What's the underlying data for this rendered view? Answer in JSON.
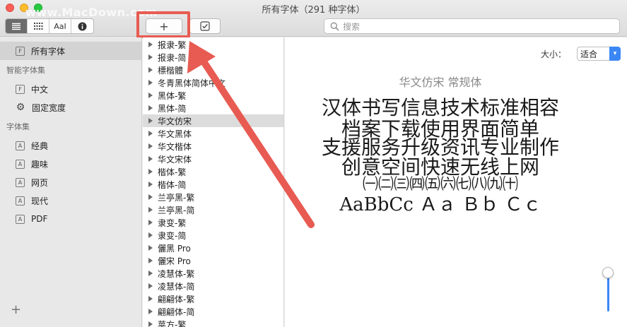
{
  "window": {
    "title": "所有字体（291 种字体）",
    "watermark": "www.MacDown.com"
  },
  "toolbar": {
    "view_buttons": [
      {
        "name": "list-view-icon",
        "active": true
      },
      {
        "name": "grid-view-icon",
        "active": false
      },
      {
        "label": "AaI",
        "name": "sample-view-button",
        "active": false
      },
      {
        "name": "info-icon",
        "active": false
      }
    ],
    "add_label": "+",
    "search_placeholder": "搜索"
  },
  "sidebar": {
    "items": [
      {
        "label": "所有字体",
        "icon": "font-icon",
        "selected": true
      }
    ],
    "groups": [
      {
        "title": "智能字体集",
        "items": [
          {
            "label": "中文",
            "icon": "font-icon"
          },
          {
            "label": "固定宽度",
            "icon": "gear-icon"
          }
        ]
      },
      {
        "title": "字体集",
        "items": [
          {
            "label": "经典",
            "icon": "collection-icon"
          },
          {
            "label": "趣味",
            "icon": "collection-icon"
          },
          {
            "label": "网页",
            "icon": "collection-icon"
          },
          {
            "label": "现代",
            "icon": "collection-icon"
          },
          {
            "label": "PDF",
            "icon": "collection-icon"
          }
        ]
      }
    ],
    "add_label": "+"
  },
  "font_list": [
    "报隶-繁",
    "报隶-简",
    "標楷體",
    "冬青黑体简体中文",
    "黑体-繁",
    "黑体-简",
    "华文仿宋",
    "华文黑体",
    "华文楷体",
    "华文宋体",
    "楷体-繁",
    "楷体-简",
    "兰亭黑-繁",
    "兰亭黑-简",
    "隶变-繁",
    "隶变-简",
    "儷黑 Pro",
    "儷宋 Pro",
    "凌慧体-繁",
    "凌慧体-简",
    "翩翩体-繁",
    "翩翩体-简",
    "苹方-繁"
  ],
  "selected_font_index": 6,
  "preview": {
    "size_label": "大小：",
    "size_value": "适合",
    "font_name": "华文仿宋 常规体",
    "lines": [
      "汉体书写信息技术标准相容",
      "档案下载使用界面简单",
      "支援服务升级资讯专业制作",
      "创意空间快速无线上网",
      "㈠㈡㈢㈣㈤㈥㈦㈧㈨㈩",
      "AaBbCc Ａａ Ｂｂ Ｃｃ"
    ],
    "size_slider_level": 0.3
  },
  "colors": {
    "accent": "#3b87f5",
    "annotation": "#e85b52"
  }
}
